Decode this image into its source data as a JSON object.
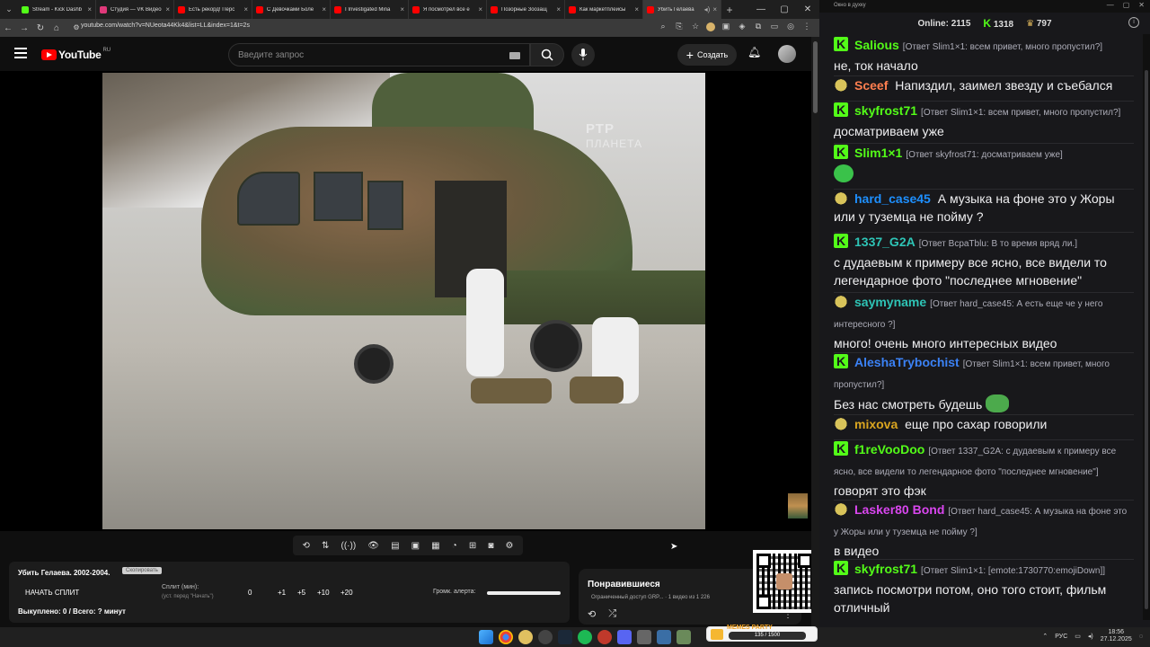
{
  "browser": {
    "tabs": [
      {
        "label": "Stream - Kick Dashb",
        "color": "#53fc18",
        "active": false
      },
      {
        "label": "Студия — VK Видео",
        "color": "#e0397a",
        "active": false
      },
      {
        "label": "Есть рекорд! Перс",
        "color": "#ff0000",
        "active": false
      },
      {
        "label": "С Девочками Боле",
        "color": "#ff0000",
        "active": false
      },
      {
        "label": "I Investigated Mina",
        "color": "#ff0000",
        "active": false
      },
      {
        "label": "Я посмотрел все е",
        "color": "#ff0000",
        "active": false
      },
      {
        "label": "Позорные Зоозащ",
        "color": "#ff0000",
        "active": false
      },
      {
        "label": "Как маркетплейсы",
        "color": "#ff0000",
        "active": false
      },
      {
        "label": "Убить Гелаева",
        "color": "#ff0000",
        "active": true
      }
    ],
    "url": "youtube.com/watch?v=NUeota44Kk4&list=LL&index=1&t=2s"
  },
  "youtube": {
    "logo_text": "YouTube",
    "region": "RU",
    "search_placeholder": "Введите запрос",
    "create_label": "Создать"
  },
  "video": {
    "watermark_line1": "РТР",
    "watermark_line2": "ПЛАНЕТА"
  },
  "split_panel": {
    "title": "Убить Гелаева. 2002-2004.",
    "copy_label": "Скопировать",
    "start_split": "НАЧАТЬ СПЛИТ",
    "split_label": "Сплит (мин):",
    "split_hint": "(уст. перед \"Начать\")",
    "split_value": "0",
    "steps": [
      "+1",
      "+5",
      "+10",
      "+20"
    ],
    "volume_label": "Громк. алерта:",
    "bought": "Выкуплено: 0 / Всего: ? минут"
  },
  "liked_panel": {
    "title": "Понравившиеся",
    "subtitle": "Ограниченный доступ GRP... · 1 видео из 1 226"
  },
  "chat": {
    "window_title": "Окно в духку",
    "online_label": "Online:",
    "online_count": "2115",
    "kick_count": "1318",
    "crown_count": "797",
    "messages": [
      {
        "badge": "kick",
        "name": "Salious",
        "color": "#53fc18",
        "reply": "[Ответ Slim1×1: всем привет, много пропустил?]",
        "text": "не, ток начало"
      },
      {
        "badge": "frog",
        "name": "Sceef",
        "color": "#ff7f50",
        "reply": "",
        "text": "Напиздил, заимел звезду и съебался"
      },
      {
        "badge": "kick",
        "name": "skyfrost71",
        "color": "#53fc18",
        "reply": "[Ответ Slim1×1: всем привет, много пропустил?]",
        "text": "досматриваем уже"
      },
      {
        "badge": "kick",
        "name": "Slim1×1",
        "color": "#53fc18",
        "reply": "[Ответ skyfrost71: досматриваем уже]",
        "text": ""
      },
      {
        "badge": "frog",
        "name": "hard_case45",
        "color": "#1e90ff",
        "reply": "",
        "text": "А музыка на фоне это у Жоры или у туземца не пойму ?"
      },
      {
        "badge": "kick",
        "name": "1337_G2A",
        "color": "#2ec4b6",
        "reply": "[Ответ ВсраТblu: В то время вряд ли.]",
        "text": "с дудаевым к примеру все ясно, все видели то легендарное фото \"последнее мгновение\""
      },
      {
        "badge": "frog",
        "name": "saymyname",
        "color": "#2ec4b6",
        "reply": "[Ответ hard_case45: А есть еще че у него интересного ?]",
        "text": "много! очень много интересных видео"
      },
      {
        "badge": "kick",
        "name": "AleshaTrybochist",
        "color": "#3b82f6",
        "reply": "[Ответ Slim1×1: всем привет, много пропустил?]",
        "text": "Без нас смотреть будешь"
      },
      {
        "badge": "frog",
        "name": "mixova",
        "color": "#daa520",
        "reply": "",
        "text": "еще про сахар говорили"
      },
      {
        "badge": "kick",
        "name": "f1reVooDoo",
        "color": "#53fc18",
        "reply": "[Ответ 1337_G2A: с дудаевым к примеру все ясно, все видели то легендарное фото \"последнее мгновение\"]",
        "text": "говорят это фэк"
      },
      {
        "badge": "frog",
        "name": "Lasker80 Bond",
        "color": "#d946ef",
        "reply": "[Ответ hard_case45: А музыка на фоне это у Жоры или у туземца не пойму ?]",
        "text": "в видео"
      },
      {
        "badge": "kick",
        "name": "skyfrost71",
        "color": "#53fc18",
        "reply": "[Ответ Slim1×1: [emote:1730770:emojiDown]]",
        "text": "запись посмотри потом, оно того стоит, фильм отличный"
      }
    ]
  },
  "taskbar": {
    "memes_party": "MEMES PARTY",
    "memes_progress": "135 / 1500",
    "lang": "РУС",
    "time": "18:56",
    "date": "27.12.2025"
  }
}
